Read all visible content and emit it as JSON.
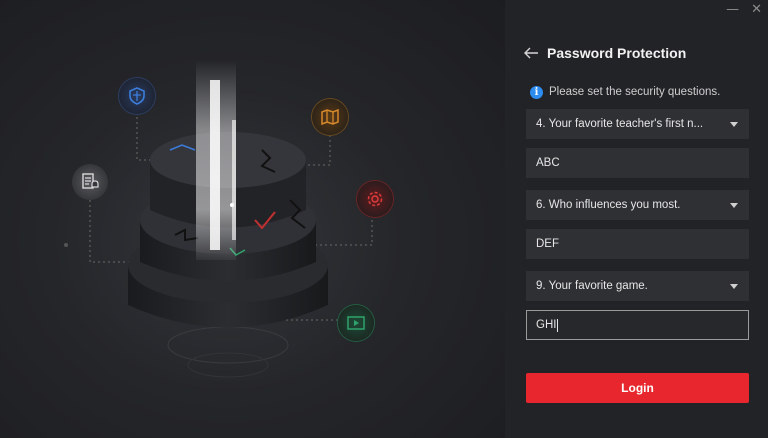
{
  "window": {
    "minimize_label": "—",
    "close_label": "✕"
  },
  "header": {
    "back_icon": "arrow-left-icon",
    "title": "Password Protection"
  },
  "hint": {
    "icon": "info-icon",
    "icon_glyph": "i",
    "text": "Please set the security questions."
  },
  "form": {
    "question1": "4. Your favorite teacher's first n...",
    "answer1": "ABC",
    "question2": "6. Who influences you most.",
    "answer2": "DEF",
    "question3": "9. Your favorite game.",
    "answer3": "GHI"
  },
  "login_label": "Login",
  "illustration": {
    "icons": [
      "shield-icon",
      "map-icon",
      "document-bell-icon",
      "gear-icon",
      "video-icon"
    ],
    "accent_colors": {
      "blue": "#3b7ddd",
      "orange": "#d98a2b",
      "red": "#e23b3b",
      "green": "#2fa36b"
    }
  },
  "colors": {
    "primary": "#e8262e",
    "info": "#2d8cf0",
    "panel": "#222326",
    "field": "#2f3034"
  }
}
